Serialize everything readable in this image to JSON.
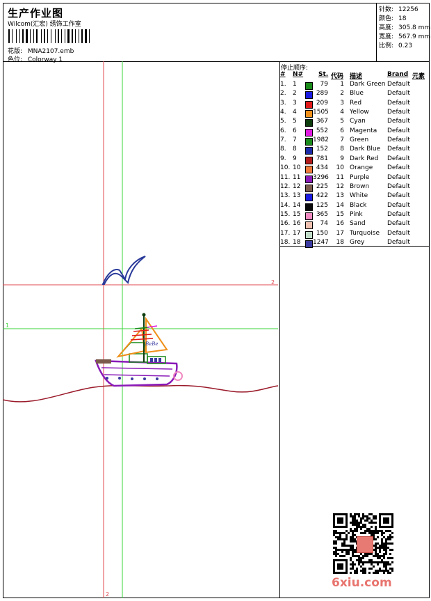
{
  "header": {
    "title": "生产作业图",
    "subtitle": "Wilcom(汇宏) 绣饰工作室",
    "design_label": "花版:",
    "design_value": "MNA2107.emb",
    "colorway_label": "色位:",
    "colorway_value": "Colorway 1"
  },
  "stats": {
    "stitches_label": "针数:",
    "stitches_value": "12256",
    "colors_label": "颜色:",
    "colors_value": "18",
    "height_label": "高度:",
    "height_value": "305.8 mm",
    "width_label": "宽度:",
    "width_value": "567.9 mm",
    "scale_label": "比例:",
    "scale_value": "0.23"
  },
  "canvas": {
    "axis_label_1": "1",
    "axis_label_2": "2",
    "axis_label_3": "2",
    "boat_text": "BeBe"
  },
  "legend": {
    "title": "停止顺序:",
    "headers": {
      "idx": "#",
      "n": "N#",
      "st": "St.",
      "code": "代码",
      "desc": "描述",
      "brand": "Brand",
      "elem": "元素"
    },
    "rows": [
      {
        "idx": "1.",
        "n": "1",
        "color": "#1a8a1a",
        "st": "79",
        "code": "1",
        "desc": "Dark Green",
        "brand": "Default"
      },
      {
        "idx": "2.",
        "n": "2",
        "color": "#1a1ae0",
        "st": "289",
        "code": "2",
        "desc": "Blue",
        "brand": "Default"
      },
      {
        "idx": "3.",
        "n": "3",
        "color": "#e01a1a",
        "st": "209",
        "code": "3",
        "desc": "Red",
        "brand": "Default"
      },
      {
        "idx": "4.",
        "n": "4",
        "color": "#f0901a",
        "st": "1505",
        "code": "4",
        "desc": "Yellow",
        "brand": "Default"
      },
      {
        "idx": "5.",
        "n": "5",
        "color": "#0d3d0d",
        "st": "367",
        "code": "5",
        "desc": "Cyan",
        "brand": "Default"
      },
      {
        "idx": "6.",
        "n": "6",
        "color": "#e01ae0",
        "st": "552",
        "code": "6",
        "desc": "Magenta",
        "brand": "Default"
      },
      {
        "idx": "7.",
        "n": "7",
        "color": "#1a8a1a",
        "st": "1982",
        "code": "7",
        "desc": "Green",
        "brand": "Default"
      },
      {
        "idx": "8.",
        "n": "8",
        "color": "#1a2aa8",
        "st": "152",
        "code": "8",
        "desc": "Dark Blue",
        "brand": "Default"
      },
      {
        "idx": "9.",
        "n": "9",
        "color": "#b01a1a",
        "st": "781",
        "code": "9",
        "desc": "Dark Red",
        "brand": "Default"
      },
      {
        "idx": "10.",
        "n": "10",
        "color": "#f07a3a",
        "st": "434",
        "code": "10",
        "desc": "Orange",
        "brand": "Default"
      },
      {
        "idx": "11.",
        "n": "11",
        "color": "#8a1ab8",
        "st": "3296",
        "code": "11",
        "desc": "Purple",
        "brand": "Default"
      },
      {
        "idx": "12.",
        "n": "12",
        "color": "#7a5a4a",
        "st": "225",
        "code": "12",
        "desc": "Brown",
        "brand": "Default"
      },
      {
        "idx": "13.",
        "n": "13",
        "color": "#1a1ae0",
        "st": "422",
        "code": "13",
        "desc": "White",
        "brand": "Default"
      },
      {
        "idx": "14.",
        "n": "14",
        "color": "#0a0a0a",
        "st": "125",
        "code": "14",
        "desc": "Black",
        "brand": "Default"
      },
      {
        "idx": "15.",
        "n": "15",
        "color": "#f08ac0",
        "st": "365",
        "code": "15",
        "desc": "Pink",
        "brand": "Default"
      },
      {
        "idx": "16.",
        "n": "16",
        "color": "#f0c0b0",
        "st": "74",
        "code": "16",
        "desc": "Sand",
        "brand": "Default"
      },
      {
        "idx": "17.",
        "n": "17",
        "color": "#c0dcc8",
        "st": "150",
        "code": "17",
        "desc": "Turquoise",
        "brand": "Default"
      },
      {
        "idx": "18.",
        "n": "18",
        "color": "#3a3aa0",
        "st": "1247",
        "code": "18",
        "desc": "Grey",
        "brand": "Default"
      }
    ]
  },
  "watermark": "6xiu.com",
  "colors": {
    "guide_red": "#e0484f",
    "guide_green": "#3ad43a",
    "wave": "#9a1a2a",
    "seagull": "#2a3a9a"
  }
}
